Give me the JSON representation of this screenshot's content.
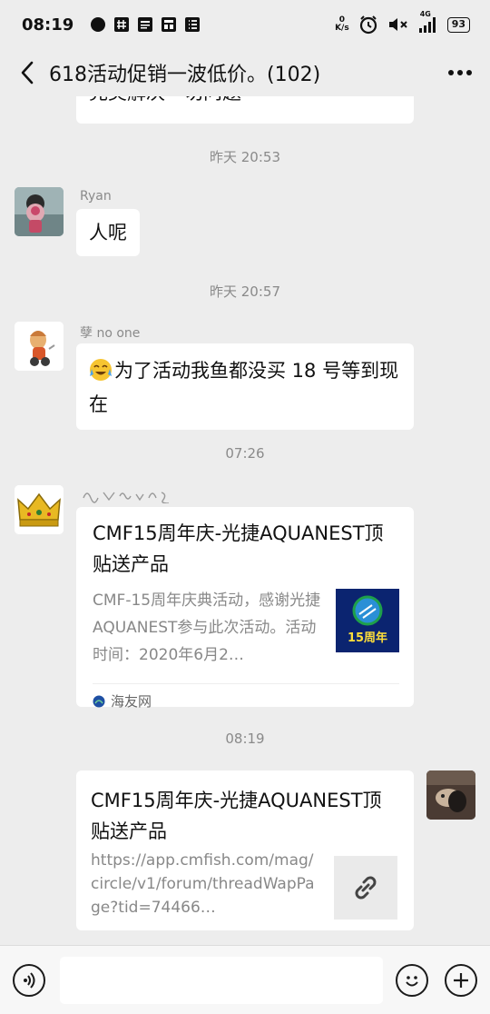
{
  "status_bar": {
    "time": "08:19",
    "network_label": "K/s",
    "network_speed": "0",
    "signal_label": "4G",
    "battery": "93"
  },
  "header": {
    "title": "618活动促销一波低价。(102)"
  },
  "messages": {
    "partial_text": "完美解决一切问题",
    "time1": "昨天 20:53",
    "ryan_name": "Ryan",
    "ryan_text": "人呢",
    "time2": "昨天 20:57",
    "noone_name": "孽 no one",
    "noone_text": "为了活动我鱼都没买 18 号等到现在",
    "time3": "07:26",
    "card1_title": "CMF15周年庆-光捷AQUANEST顶贴送产品",
    "card1_desc": "CMF-15周年庆典活动，感谢光捷AQUANEST参与此次活动。活动时间：2020年6月2…",
    "card1_thumb_text": "15周年",
    "card1_source": "海友网",
    "time4": "08:19",
    "card2_title": "CMF15周年庆-光捷AQUANEST顶贴送产品",
    "card2_url": "https://app.cmfish.com/mag/circle/v1/forum/threadWapPage?tid=74466…"
  },
  "colors": {
    "background": "#ededed",
    "bubble": "#ffffff",
    "muted_text": "#8a8a8a"
  }
}
